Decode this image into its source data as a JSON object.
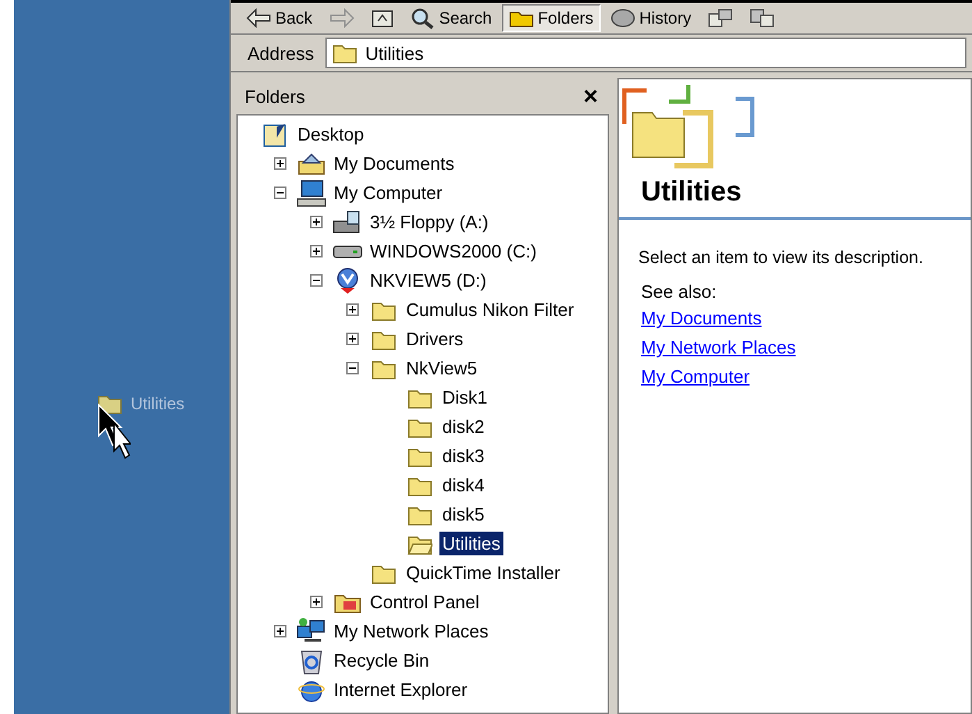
{
  "desktop": {
    "drag_item": {
      "label": "Utilities"
    }
  },
  "toolbar": [
    {
      "kind": "back",
      "label": "Back",
      "selected": false
    },
    {
      "kind": "forward",
      "selected": false
    },
    {
      "kind": "up",
      "selected": false
    },
    {
      "kind": "search",
      "label": "Search",
      "selected": false
    },
    {
      "kind": "folders",
      "label": "Folders",
      "selected": true
    },
    {
      "kind": "history",
      "label": "History",
      "selected": false
    },
    {
      "kind": "move",
      "selected": false
    },
    {
      "kind": "copy",
      "selected": false
    }
  ],
  "address": {
    "label": "Address",
    "value": "Utilities"
  },
  "folders_pane": {
    "title": "Folders",
    "close": "×"
  },
  "tree": [
    {
      "label": "Desktop",
      "kind": "desktop",
      "selected": false,
      "children": [
        {
          "label": "My Documents",
          "kind": "documents",
          "expanded": false,
          "selected": false
        },
        {
          "label": "My Computer",
          "kind": "computer",
          "expanded": true,
          "selected": false,
          "children": [
            {
              "label": "3½ Floppy (A:)",
              "kind": "floppy",
              "expanded": false,
              "selected": false
            },
            {
              "label": "WINDOWS2000 (C:)",
              "kind": "drive",
              "expanded": false,
              "selected": false
            },
            {
              "label": "NKVIEW5 (D:)",
              "kind": "cdrom",
              "expanded": true,
              "selected": false,
              "children": [
                {
                  "label": "Cumulus Nikon Filter",
                  "kind": "folder",
                  "expanded": false,
                  "selected": false
                },
                {
                  "label": "Drivers",
                  "kind": "folder",
                  "expanded": false,
                  "selected": false
                },
                {
                  "label": "NkView5",
                  "kind": "folder",
                  "expanded": true,
                  "selected": false,
                  "children": [
                    {
                      "label": "Disk1",
                      "kind": "folder",
                      "selected": false
                    },
                    {
                      "label": "disk2",
                      "kind": "folder",
                      "selected": false
                    },
                    {
                      "label": "disk3",
                      "kind": "folder",
                      "selected": false
                    },
                    {
                      "label": "disk4",
                      "kind": "folder",
                      "selected": false
                    },
                    {
                      "label": "disk5",
                      "kind": "folder",
                      "selected": false
                    },
                    {
                      "label": "Utilities",
                      "kind": "folder",
                      "selected": true
                    }
                  ]
                },
                {
                  "label": "QuickTime Installer",
                  "kind": "folder",
                  "selected": false
                }
              ]
            },
            {
              "label": "Control Panel",
              "kind": "control",
              "expanded": false,
              "selected": false
            }
          ]
        },
        {
          "label": "My Network Places",
          "kind": "network",
          "expanded": false,
          "selected": false
        },
        {
          "label": "Recycle Bin",
          "kind": "recycle",
          "selected": false
        },
        {
          "label": "Internet Explorer",
          "kind": "ie",
          "selected": false
        }
      ]
    }
  ],
  "content": {
    "title": "Utilities",
    "description": "Select an item to view its description.",
    "see_also": "See also:",
    "links": [
      "My Documents",
      "My Network Places",
      "My Computer"
    ]
  }
}
